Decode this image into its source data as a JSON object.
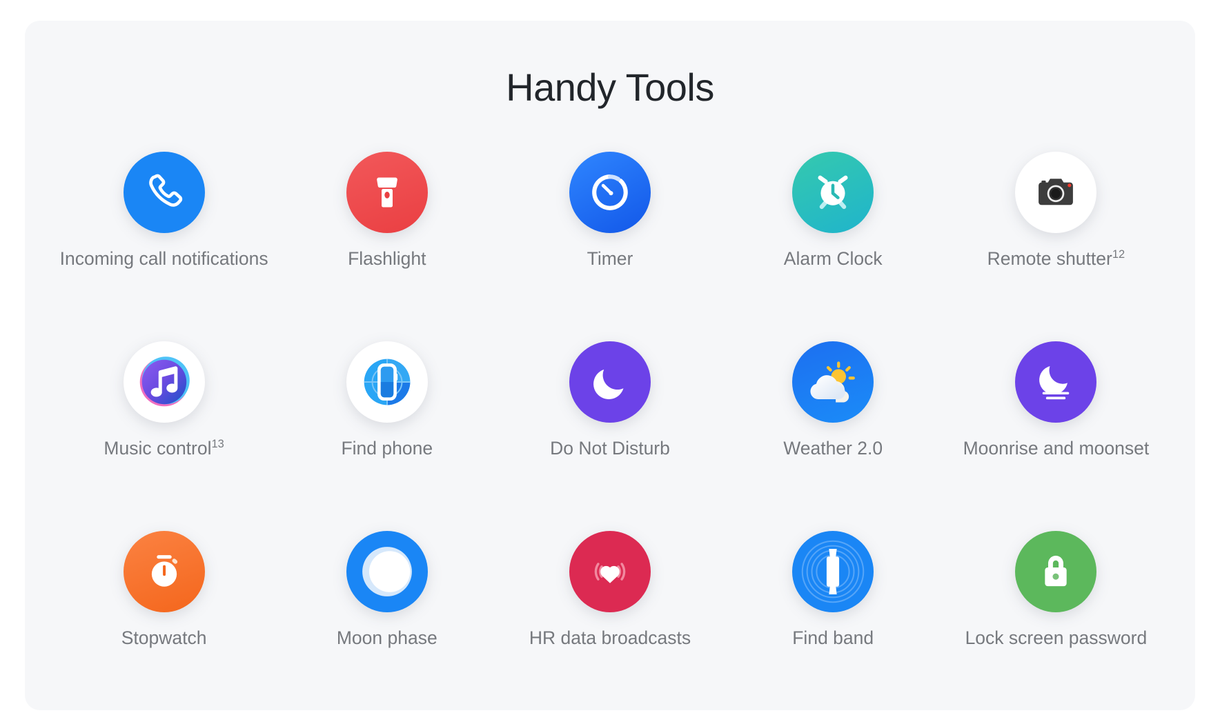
{
  "page": {
    "title": "Handy Tools",
    "background_color": "#ffffff",
    "card_color": "#f6f7f9",
    "title_color": "#22262b",
    "label_color": "#76797e"
  },
  "tools": [
    {
      "id": "incoming-call-notifications",
      "label": "Incoming call notifications",
      "sup": "",
      "icon": "phone-icon",
      "color": "#1a86f5"
    },
    {
      "id": "flashlight",
      "label": "Flashlight",
      "sup": "",
      "icon": "flashlight-icon",
      "color": "#ef4a4a"
    },
    {
      "id": "timer",
      "label": "Timer",
      "sup": "",
      "icon": "timer-icon",
      "color": "#1d6ff2"
    },
    {
      "id": "alarm-clock",
      "label": "Alarm Clock",
      "sup": "",
      "icon": "alarm-clock-icon",
      "color": "#27bdb8"
    },
    {
      "id": "remote-shutter",
      "label": "Remote shutter",
      "sup": "12",
      "icon": "camera-icon",
      "color": "#ffffff"
    },
    {
      "id": "music-control",
      "label": "Music control",
      "sup": "13",
      "icon": "music-note-icon",
      "color": "#ffffff"
    },
    {
      "id": "find-phone",
      "label": "Find phone",
      "sup": "",
      "icon": "find-phone-icon",
      "color": "#ffffff"
    },
    {
      "id": "do-not-disturb",
      "label": "Do Not Disturb",
      "sup": "",
      "icon": "crescent-moon-icon",
      "color": "#6c42e8"
    },
    {
      "id": "weather",
      "label": "Weather 2.0",
      "sup": "",
      "icon": "sun-cloud-icon",
      "color": "#1377ef"
    },
    {
      "id": "moonrise-and-moonset",
      "label": "Moonrise and moonset",
      "sup": "",
      "icon": "moonrise-icon",
      "color": "#6c42e8"
    },
    {
      "id": "stopwatch",
      "label": "Stopwatch",
      "sup": "",
      "icon": "stopwatch-icon",
      "color": "#f97228"
    },
    {
      "id": "moon-phase",
      "label": "Moon phase",
      "sup": "",
      "icon": "moon-phase-icon",
      "color": "#1a86f5"
    },
    {
      "id": "hr-data-broadcasts",
      "label": "HR data broadcasts",
      "sup": "",
      "icon": "heart-broadcast-icon",
      "color": "#dc2a52"
    },
    {
      "id": "find-band",
      "label": "Find band",
      "sup": "",
      "icon": "find-band-icon",
      "color": "#1a86f5"
    },
    {
      "id": "lock-screen-password",
      "label": "Lock screen password",
      "sup": "",
      "icon": "padlock-icon",
      "color": "#5cb85c"
    }
  ]
}
